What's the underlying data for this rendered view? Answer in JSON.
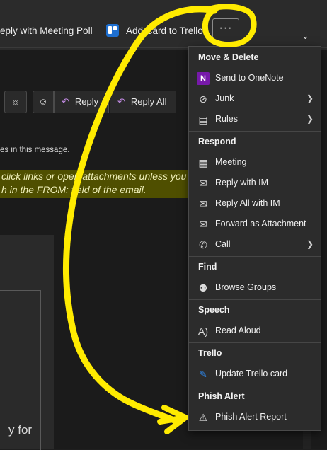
{
  "ribbon": {
    "reply_with_meeting_poll": "eply with Meeting Poll",
    "add_card_to_trello": "Add Card to Trello",
    "more_label": "···"
  },
  "message": {
    "actions": {
      "reply": "Reply",
      "reply_all": "Reply All"
    },
    "note": "es in this message.",
    "warning_line1": "click links or open attachments unless you",
    "warning_line2": "h in the FROM: field of the email.",
    "body_fragment": "y for"
  },
  "menu": {
    "sections": [
      {
        "title": "Move & Delete",
        "items": [
          {
            "label": "Send to OneNote",
            "icon": "onenote-icon"
          },
          {
            "label": "Junk",
            "icon": "junk-icon",
            "submenu": true
          },
          {
            "label": "Rules",
            "icon": "rules-icon",
            "submenu": true
          }
        ]
      },
      {
        "title": "Respond",
        "items": [
          {
            "label": "Meeting",
            "icon": "meeting-icon"
          },
          {
            "label": "Reply with IM",
            "icon": "chat-icon"
          },
          {
            "label": "Reply All with IM",
            "icon": "chat-icon"
          },
          {
            "label": "Forward as Attachment",
            "icon": "forward-attachment-icon"
          },
          {
            "label": "Call",
            "icon": "phone-icon",
            "submenu": true
          }
        ]
      },
      {
        "title": "Find",
        "items": [
          {
            "label": "Browse Groups",
            "icon": "groups-icon"
          }
        ]
      },
      {
        "title": "Speech",
        "items": [
          {
            "label": "Read Aloud",
            "icon": "read-aloud-icon"
          }
        ]
      },
      {
        "title": "Trello",
        "items": [
          {
            "label": "Update Trello card",
            "icon": "trello-pencil-icon"
          }
        ]
      },
      {
        "title": "Phish Alert",
        "items": [
          {
            "label": "Phish Alert Report",
            "icon": "phish-alert-icon"
          }
        ]
      }
    ]
  },
  "colors": {
    "annotation": "#ffeb00",
    "warning_banner": "#4f4f00",
    "accent_purple": "#c68de8",
    "menu_bg": "#2c2c2c"
  }
}
